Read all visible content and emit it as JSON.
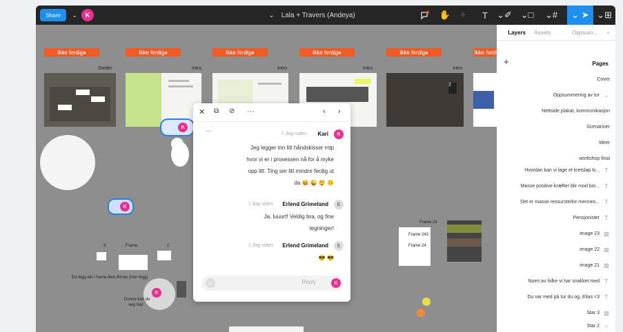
{
  "toolbar": {
    "share_label": "Share",
    "user_initial": "K",
    "title": "Lala + Travers (Andeya)",
    "title_chevron": "⌄",
    "icons": [
      "frame-grid-icon",
      "move-icon",
      "frame-icon",
      "shape-icon",
      "pen-icon",
      "text-icon",
      "components-icon",
      "hand-icon",
      "comment-icon"
    ]
  },
  "frames": [
    {
      "tag": "Ikke ferdig",
      "name": "Steder"
    },
    {
      "tag": "Ikke ferdig",
      "name": "Intro"
    },
    {
      "tag": "Ikke ferdig",
      "name": "Intro"
    },
    {
      "tag": "Ikke ferdig",
      "name": "Intro"
    },
    {
      "tag": "Ikke ferdig",
      "name": "Intro"
    },
    {
      "tag": "Ikke ferdig",
      "name": ""
    }
  ],
  "canvas_labels": {
    "frame24": "Frame 24",
    "frame243": "Frame 243",
    "frame241": "Frame 24",
    "frame_small": "Frame",
    "num3": "3",
    "num1": "1",
    "num2": "2",
    "du_legg": "Du legg ein i frame dine firmas (mer legg)",
    "dunne": "Dunne kan du",
    "dunne2": "veg mer"
  },
  "comment": {
    "messages": [
      {
        "author": "Kari",
        "initial": "K",
        "time": "1 dag siden",
        "text": [
          "Jeg legger inn litt håndskisser mtp",
          "hvor vi er i prosessen nå for å myke",
          "opp litt. Ting ser litt mindre ferdig ut",
          "da 😆 😜 😲 🙃"
        ]
      },
      {
        "author": "Erlend Grimeland",
        "initial": "E",
        "time": "1 dag siden",
        "text": [
          "Ja, luuurt! Veldig bra, og fine",
          "tegninger!"
        ]
      },
      {
        "author": "Erlend Grimeland",
        "initial": "E",
        "time": "1 dag siden",
        "text": [
          "😎 😎"
        ]
      }
    ],
    "reply_placeholder": "Reply",
    "reply_initial": "K"
  },
  "panel": {
    "tabs": [
      "Layers",
      "Assets",
      "Oppsum..."
    ],
    "pages_header": "Pages",
    "add_label": "+",
    "pages": [
      {
        "label": "Cover",
        "icon": ""
      },
      {
        "label": "Oppsummering av tur",
        "icon": "chevron"
      },
      {
        "label": "Nettside plakat, kommunikasjon",
        "icon": ""
      },
      {
        "label": "Scenarioer",
        "icon": ""
      },
      {
        "label": "Ideer",
        "icon": ""
      },
      {
        "label": "workshop final",
        "icon": ""
      }
    ],
    "layers": [
      {
        "label": "Hvordan kan vi lage et kretslap tv...",
        "icon": "T"
      },
      {
        "label": "Masse positive kræfter blir mod bio...",
        "icon": "T"
      },
      {
        "label": "Det er masse ressursterke mennes...",
        "icon": "T"
      },
      {
        "label": "Pensjonister",
        "icon": "T"
      },
      {
        "label": "image 23",
        "icon": "img"
      },
      {
        "label": "image 22",
        "icon": "img"
      },
      {
        "label": "image 21",
        "icon": "img"
      },
      {
        "label": "Noen av folke vi har snakket med",
        "icon": "T"
      },
      {
        "label": "Du var med på tur du og, Elias <3",
        "icon": "T"
      },
      {
        "label": "Star 3",
        "icon": "img"
      },
      {
        "label": "Star 2",
        "icon": "star"
      }
    ]
  },
  "colors": {
    "accent": "#1e8ef0",
    "tag": "#f15a22",
    "avatar": "#e8308f",
    "canvas": "#8e8e8e"
  }
}
